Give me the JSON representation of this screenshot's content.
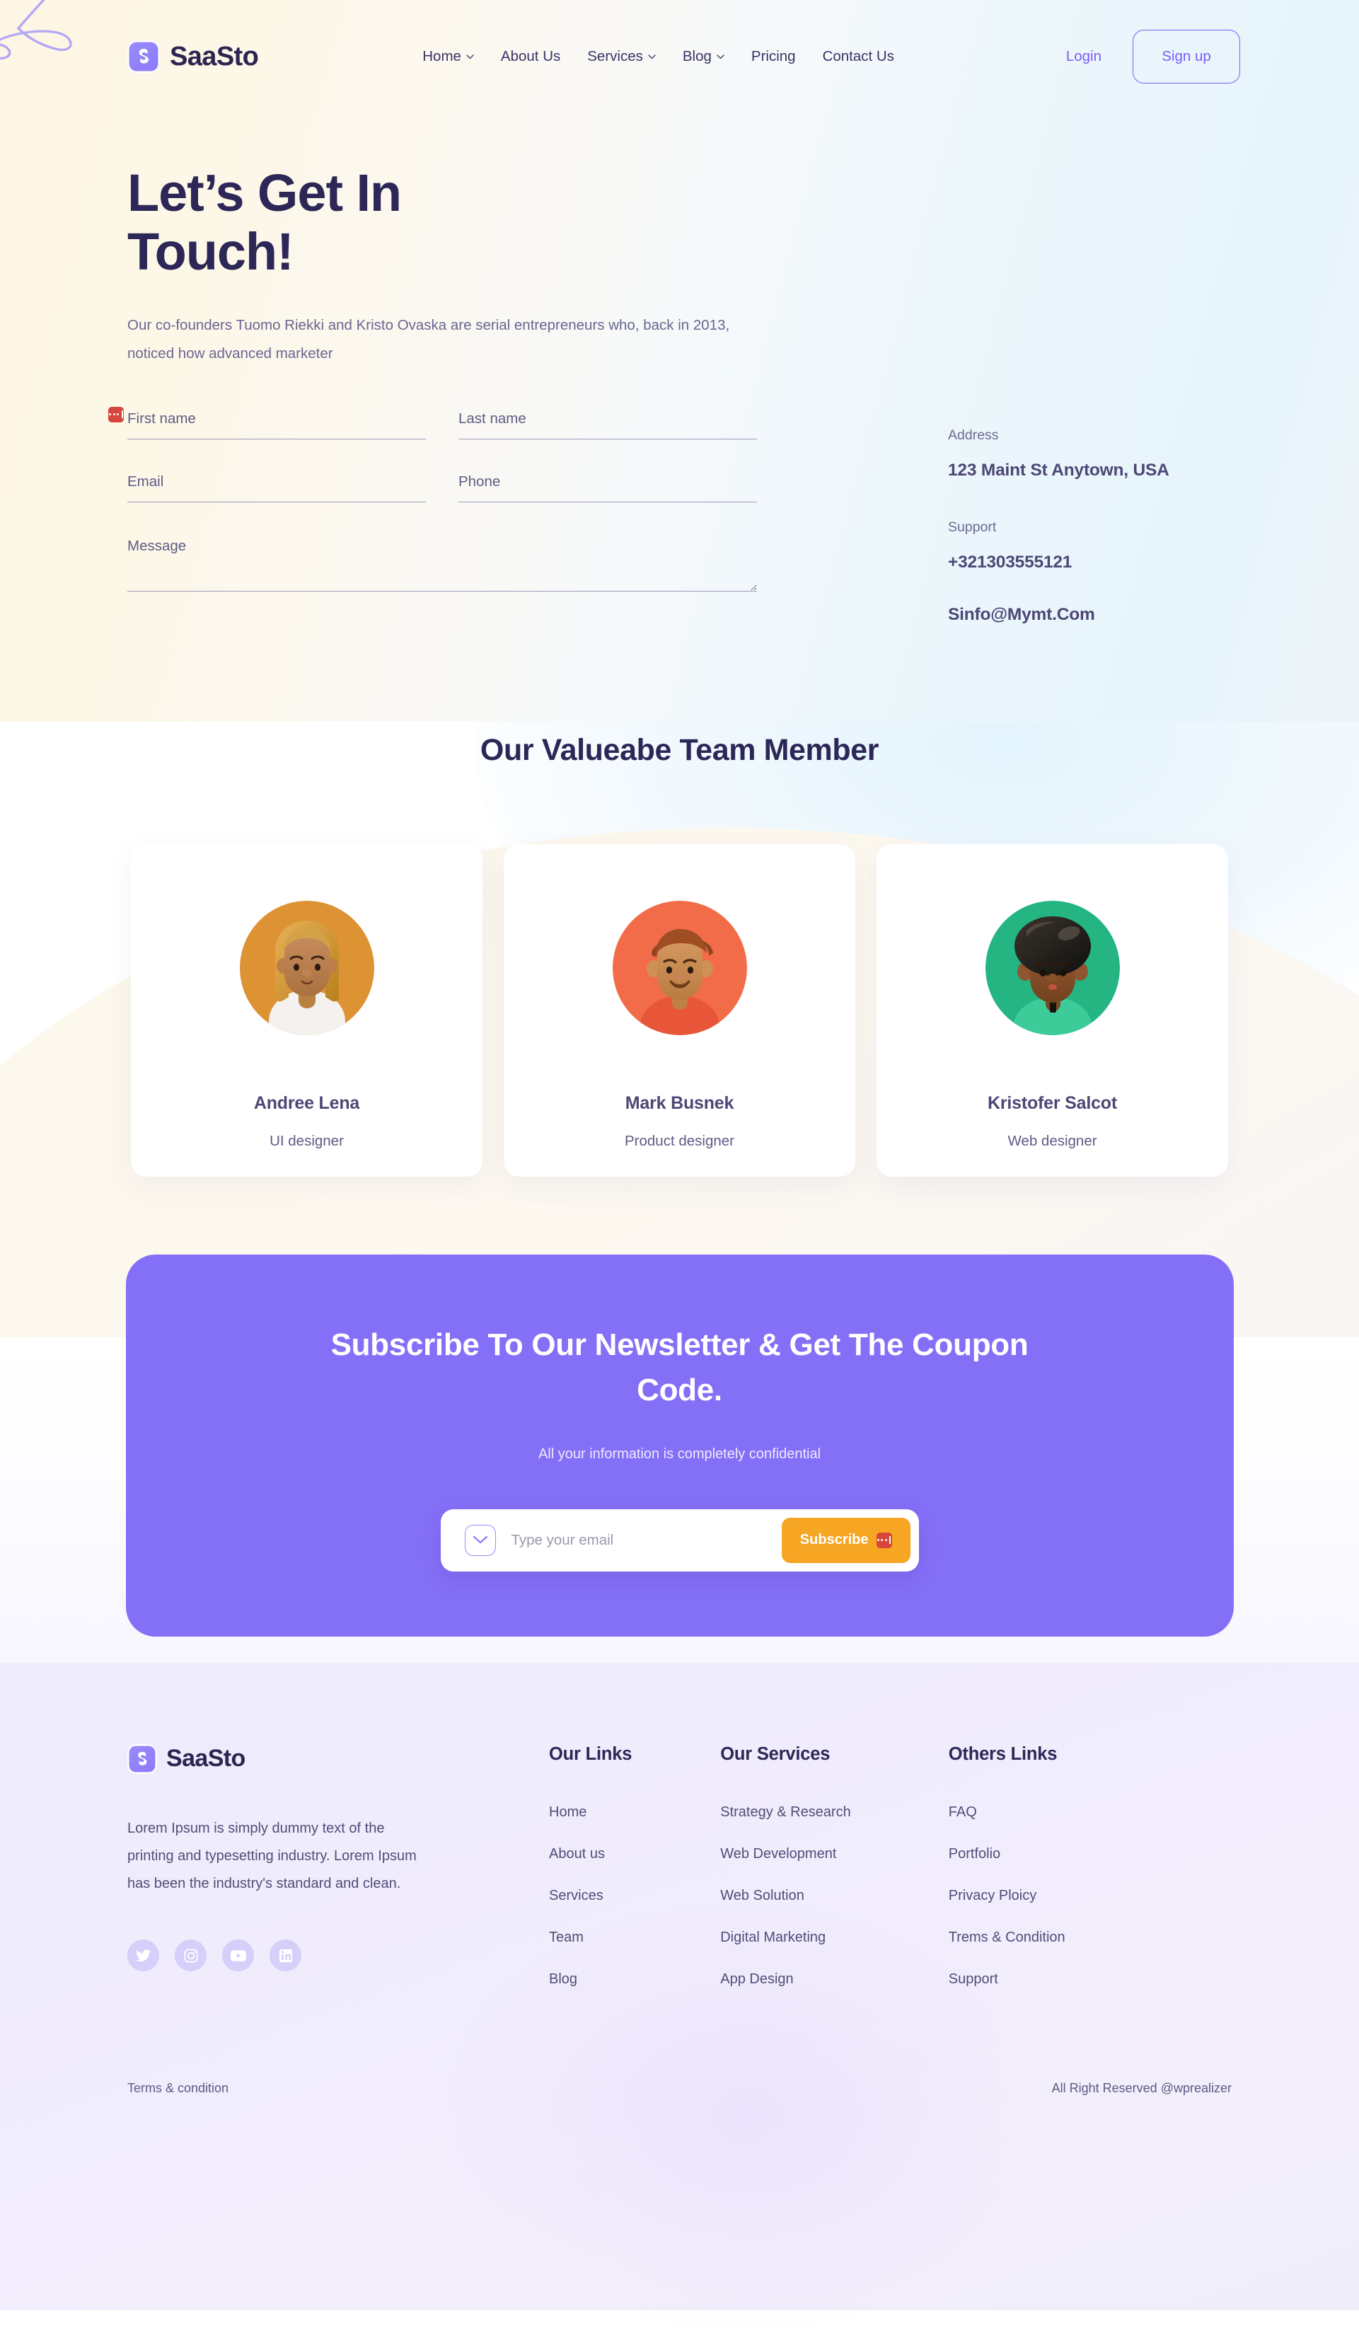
{
  "brand": {
    "name": "SaaSto",
    "logo_icon": "saasto-s-logo",
    "accent": "#7c5cfa"
  },
  "nav": {
    "items": [
      {
        "label": "Home",
        "has_dropdown": true
      },
      {
        "label": "About Us",
        "has_dropdown": false
      },
      {
        "label": "Services",
        "has_dropdown": true
      },
      {
        "label": "Blog",
        "has_dropdown": true
      },
      {
        "label": "Pricing",
        "has_dropdown": false
      },
      {
        "label": "Contact Us",
        "has_dropdown": false
      }
    ],
    "login_label": "Login",
    "signup_label": "Sign up"
  },
  "hero": {
    "title_line1": "Let’s Get In",
    "title_line2": "Touch!",
    "description": "Our co-founders Tuomo Riekki and Kristo Ovaska are serial entrepreneurs who, back in 2013, noticed how advanced marketer"
  },
  "form": {
    "first_name_placeholder": "First name",
    "last_name_placeholder": "Last name",
    "email_placeholder": "Email",
    "phone_placeholder": "Phone",
    "message_placeholder": "Message",
    "first_name_value": "",
    "last_name_value": "",
    "email_value": "",
    "phone_value": "",
    "message_value": "",
    "autofill_badge_icon": "lastpass-autofill-icon"
  },
  "contact_info": {
    "address_label": "Address",
    "address_value": "123 Maint St Anytown, USA",
    "support_label": "Support",
    "phone_value": "+321303555121",
    "email_value": "Sinfo@Mymt.Com"
  },
  "team": {
    "title": "Our Valueabe Team Member",
    "members": [
      {
        "name": "Andree Lena",
        "role": "UI designer",
        "avatar_bg": "#dd9233",
        "avatar_icon": "avatar-woman-blonde"
      },
      {
        "name": "Mark Busnek",
        "role": "Product designer",
        "avatar_bg": "#f26c4a",
        "avatar_icon": "avatar-man-mustache"
      },
      {
        "name": "Kristofer Salcot",
        "role": "Web designer",
        "avatar_bg": "#24b583",
        "avatar_icon": "avatar-man-afro"
      }
    ]
  },
  "subscribe": {
    "title": "Subscribe To Our Newsletter & Get The Coupon Code.",
    "subtitle": "All your information is completely confidential",
    "email_placeholder": "Type your email",
    "email_value": "",
    "button_label": "Subscribe",
    "mail_icon": "envelope-icon",
    "autofill_badge_icon": "lastpass-autofill-icon",
    "card_color": "#8470f7",
    "button_color": "#f6a623"
  },
  "footer": {
    "brand_name": "SaaSto",
    "about": "Lorem Ipsum is simply dummy text of the printing and typesetting industry. Lorem Ipsum has been the industry's standard and clean.",
    "socials": [
      {
        "name": "twitter-icon"
      },
      {
        "name": "instagram-icon"
      },
      {
        "name": "youtube-icon"
      },
      {
        "name": "linkedin-icon"
      }
    ],
    "columns": [
      {
        "title": "Our Links",
        "links": [
          "Home",
          "About us",
          "Services",
          "Team",
          "Blog"
        ]
      },
      {
        "title": "Our Services",
        "links": [
          "Strategy & Research",
          "Web Development",
          "Web Solution",
          "Digital Marketing",
          "App Design"
        ]
      },
      {
        "title": "Others Links",
        "links": [
          "FAQ",
          "Portfolio",
          "Privacy Ploicy",
          "Trems & Condition",
          "Support"
        ]
      }
    ],
    "terms_label": "Terms & condition",
    "copyright": "All Right Reserved @wprealizer"
  }
}
